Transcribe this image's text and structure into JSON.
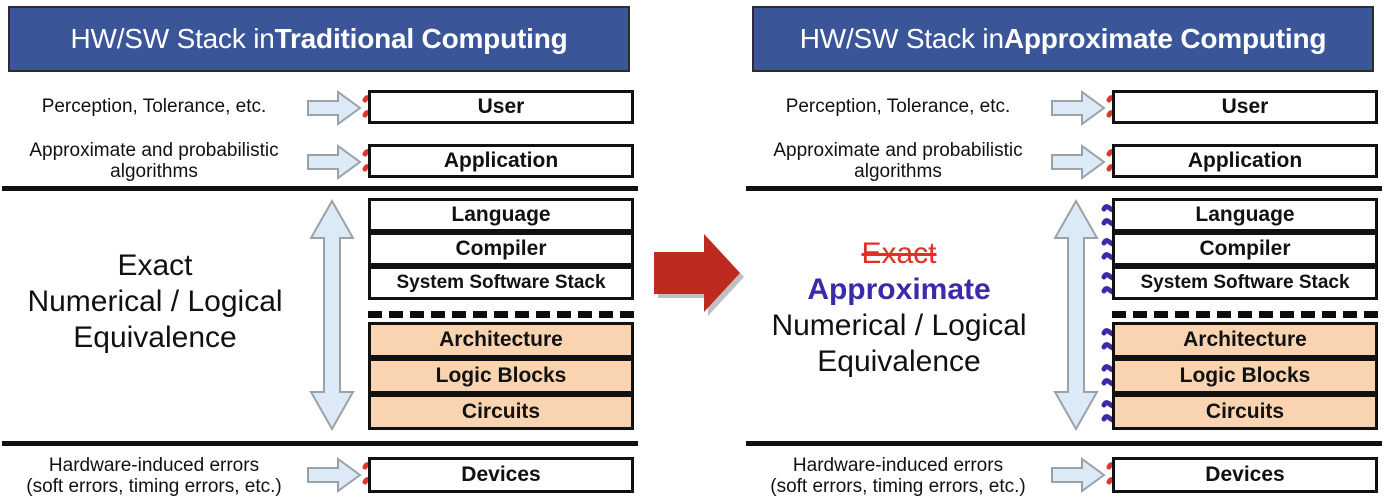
{
  "diagram": {
    "title_left": "HW/SW Stack in Traditional Computing",
    "title_right": "HW/SW Stack in Approximate Computing",
    "colors": {
      "header_blue": "#3B5599",
      "peach": "#FAD4B0",
      "arrow_red": "#BE2A20",
      "squiggle_red": "#E2342A",
      "squiggle_blue": "#3A2BA8",
      "light_blue_arrow": "#DCE9F6",
      "exact_red": "#E03124",
      "approximate_blue": "#3A2BA8"
    }
  },
  "panels": [
    {
      "id": "traditional",
      "header": {
        "plain": "HW/SW Stack in ",
        "bold": "Traditional Computing"
      },
      "top_rows": [
        {
          "label": "Perception, Tolerance, etc.",
          "box": "User",
          "squiggle": "red"
        },
        {
          "label": "Approximate and probabilistic algorithms",
          "box": "Application",
          "squiggle": "red"
        }
      ],
      "equivalence": {
        "struck": "",
        "approximate": "",
        "first": "Exact",
        "rest": "Numerical / Logical\nEquivalence"
      },
      "software_layers": [
        {
          "label": "Language",
          "squiggle": "none"
        },
        {
          "label": "Compiler",
          "squiggle": "none"
        },
        {
          "label": "System Software Stack",
          "squiggle": "none"
        }
      ],
      "hardware_layers": [
        {
          "label": "Architecture",
          "squiggle": "none"
        },
        {
          "label": "Logic Blocks",
          "squiggle": "none"
        },
        {
          "label": "Circuits",
          "squiggle": "none"
        }
      ],
      "bottom_row": {
        "label_line1": "Hardware-induced errors",
        "label_line2": "(soft errors, timing errors, etc.)",
        "box": "Devices",
        "squiggle": "red"
      }
    },
    {
      "id": "approximate",
      "header": {
        "plain": "HW/SW Stack in ",
        "bold": "Approximate Computing"
      },
      "top_rows": [
        {
          "label": "Perception, Tolerance, etc.",
          "box": "User",
          "squiggle": "red"
        },
        {
          "label": "Approximate and probabilistic algorithms",
          "box": "Application",
          "squiggle": "red"
        }
      ],
      "equivalence": {
        "struck": "Exact",
        "approximate": "Approximate",
        "first": "",
        "rest": "Numerical / Logical\nEquivalence"
      },
      "software_layers": [
        {
          "label": "Language",
          "squiggle": "blue"
        },
        {
          "label": "Compiler",
          "squiggle": "blue"
        },
        {
          "label": "System Software Stack",
          "squiggle": "blue"
        }
      ],
      "hardware_layers": [
        {
          "label": "Architecture",
          "squiggle": "blue"
        },
        {
          "label": "Logic Blocks",
          "squiggle": "blue"
        },
        {
          "label": "Circuits",
          "squiggle": "blue"
        }
      ],
      "bottom_row": {
        "label_line1": "Hardware-induced errors",
        "label_line2": "(soft errors, timing errors, etc.)",
        "box": "Devices",
        "squiggle": "red"
      }
    }
  ],
  "center_arrow": {
    "icon": "right-arrow-icon"
  }
}
